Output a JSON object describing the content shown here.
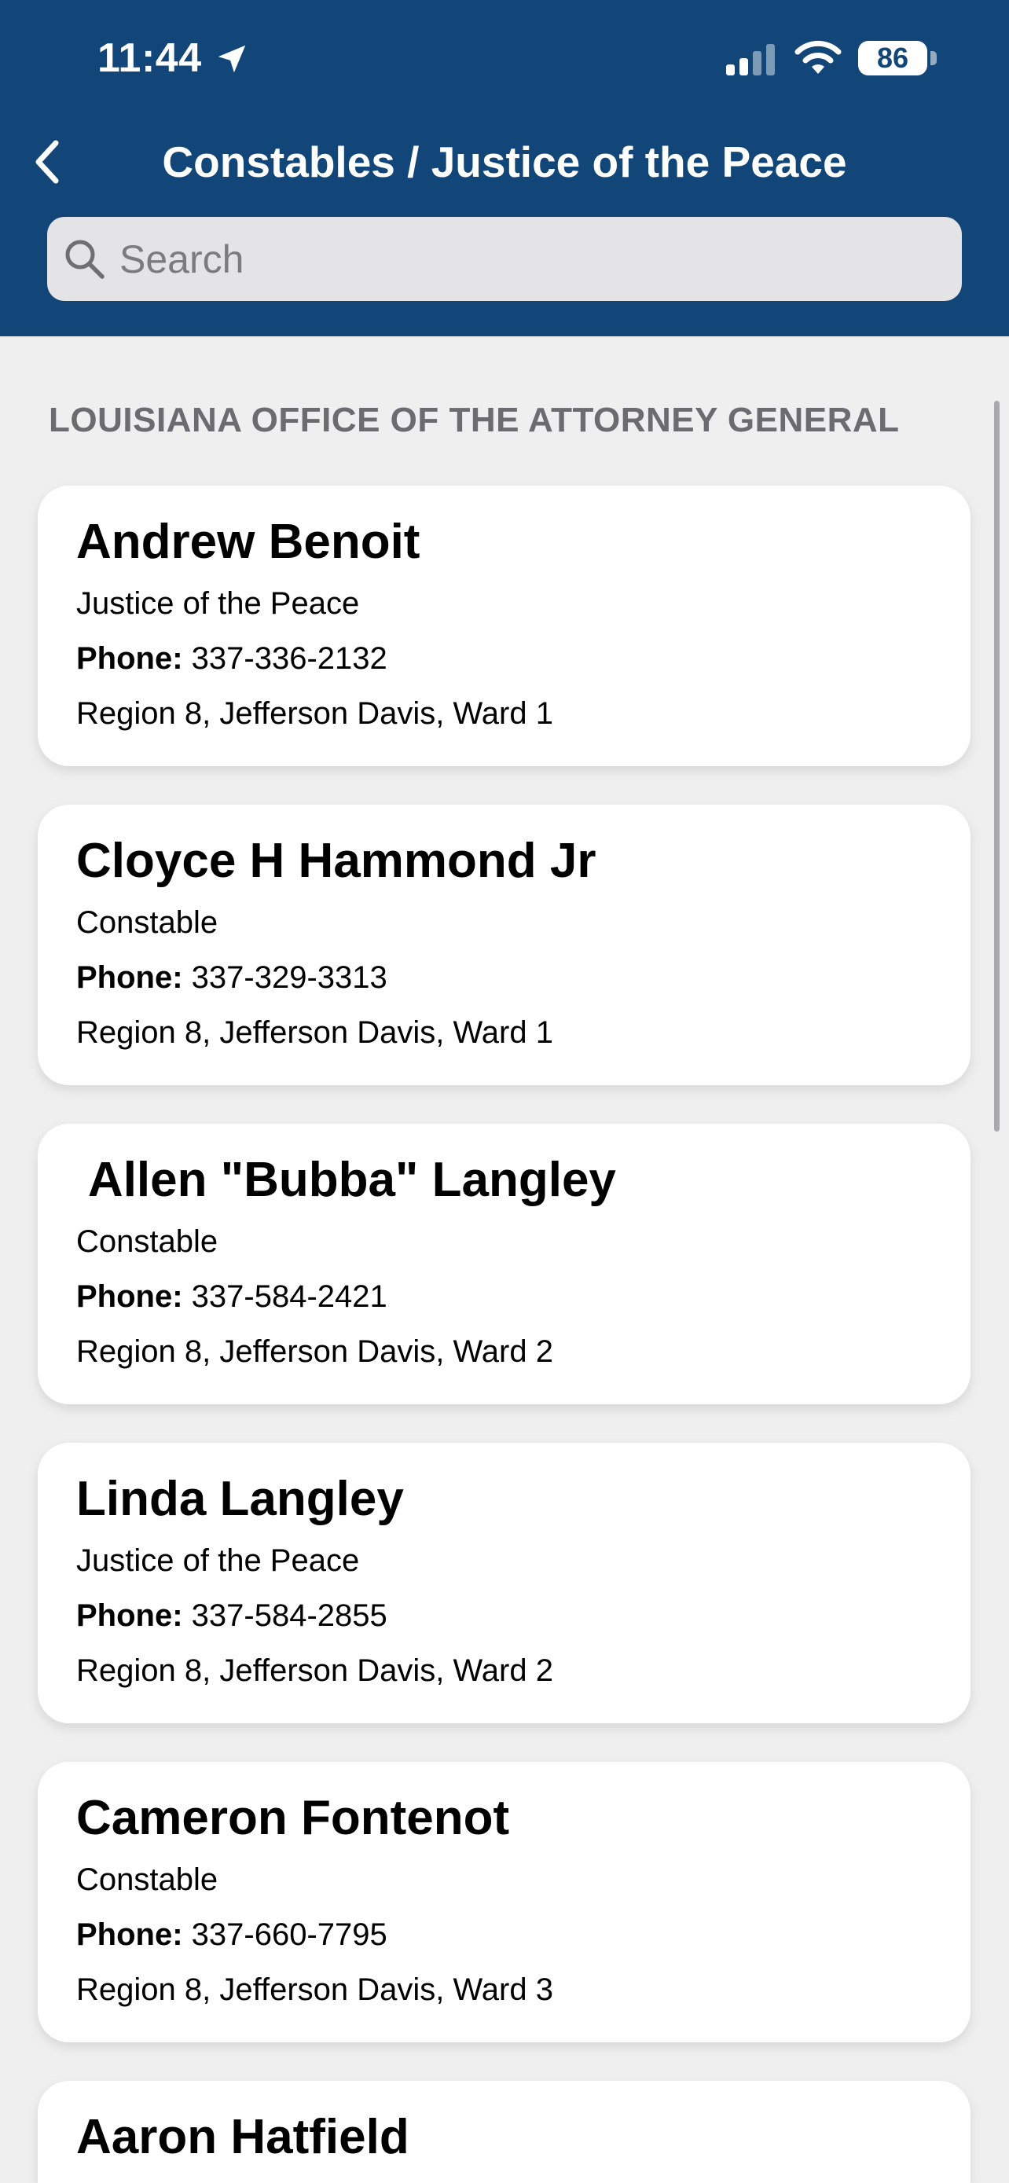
{
  "status_bar": {
    "time": "11:44",
    "battery": "86"
  },
  "nav": {
    "title": "Constables / Justice of the Peace"
  },
  "search": {
    "placeholder": "Search",
    "value": ""
  },
  "section": {
    "header": "LOUISIANA OFFICE OF THE ATTORNEY GENERAL"
  },
  "phone_label": "Phone:",
  "contacts": [
    {
      "name": "Andrew Benoit",
      "role": "Justice of the Peace",
      "phone": "337-336-2132",
      "region": "Region 8, Jefferson Davis, Ward 1"
    },
    {
      "name": "Cloyce H Hammond Jr",
      "role": "Constable",
      "phone": "337-329-3313",
      "region": "Region 8, Jefferson Davis, Ward 1"
    },
    {
      "name": " Allen \"Bubba\" Langley",
      "role": "Constable",
      "phone": "337-584-2421",
      "region": "Region 8, Jefferson Davis, Ward 2"
    },
    {
      "name": "Linda Langley",
      "role": "Justice of the Peace",
      "phone": "337-584-2855",
      "region": "Region 8, Jefferson Davis, Ward 2"
    },
    {
      "name": "Cameron Fontenot",
      "role": "Constable",
      "phone": "337-660-7795",
      "region": "Region 8, Jefferson Davis, Ward 3"
    },
    {
      "name": "Aaron Hatfield",
      "role": "",
      "phone": "",
      "region": ""
    }
  ],
  "colors": {
    "header_bg": "#124578",
    "page_bg": "#efeff0",
    "card_bg": "#ffffff"
  }
}
